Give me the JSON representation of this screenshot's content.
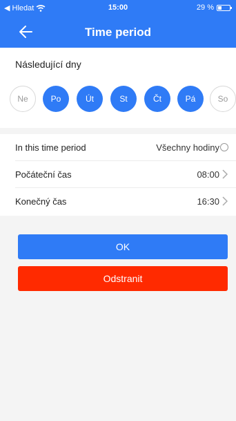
{
  "status_bar": {
    "back_app": "◀ Hledat",
    "time": "15:00",
    "battery": "29 %"
  },
  "header": {
    "title": "Time period"
  },
  "days": {
    "label": "Následující dny",
    "items": [
      {
        "label": "Ne",
        "selected": false
      },
      {
        "label": "Po",
        "selected": true
      },
      {
        "label": "Út",
        "selected": true
      },
      {
        "label": "St",
        "selected": true
      },
      {
        "label": "Čt",
        "selected": true
      },
      {
        "label": "Pá",
        "selected": true
      },
      {
        "label": "So",
        "selected": false
      }
    ]
  },
  "settings": {
    "period": {
      "label": "In this time period",
      "option": "Všechny hodiny"
    },
    "start": {
      "label": "Počáteční čas",
      "value": "08:00"
    },
    "end": {
      "label": "Konečný čas",
      "value": "16:30"
    }
  },
  "buttons": {
    "ok": "OK",
    "delete": "Odstranit"
  },
  "colors": {
    "accent": "#2f7bf6",
    "danger": "#ff2a00"
  }
}
